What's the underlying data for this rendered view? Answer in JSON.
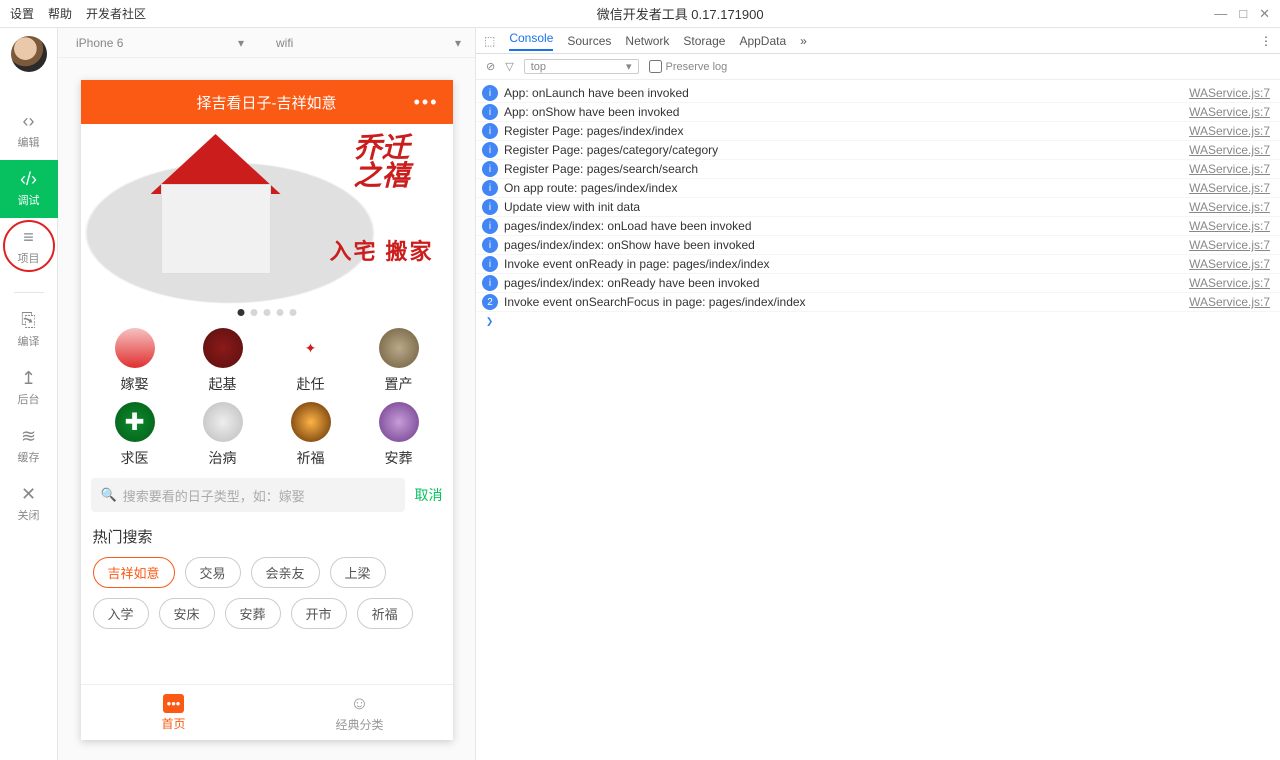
{
  "titlebar": {
    "menus": [
      "设置",
      "帮助",
      "开发者社区"
    ],
    "title": "微信开发者工具 0.17.171900"
  },
  "sidebar": {
    "items": [
      {
        "icon": "‹›",
        "label": "编辑"
      },
      {
        "icon": "‹/›",
        "label": "调试"
      },
      {
        "icon": "≡",
        "label": "项目"
      },
      {
        "icon": "⎘",
        "label": "编译"
      },
      {
        "icon": "↥",
        "label": "后台"
      },
      {
        "icon": "≋",
        "label": "缓存"
      },
      {
        "icon": "✕",
        "label": "关闭"
      }
    ]
  },
  "simtop": {
    "device": "iPhone 6",
    "network": "wifi"
  },
  "phone": {
    "title": "择吉看日子-吉祥如意",
    "banner": {
      "seal": "乔迁\n之禧",
      "moving": "入宅 搬家"
    },
    "grid": [
      {
        "label": "嫁娶",
        "bg": "linear-gradient(#f7c1c1,#e03030)"
      },
      {
        "label": "起基",
        "bg": "radial-gradient(#8b1a1a,#5a0f0f)"
      },
      {
        "label": "赴任",
        "bg": "radial-gradient(#fff,#fff)",
        "fg": "#cc1d1d"
      },
      {
        "label": "置产",
        "bg": "radial-gradient(#b9a88a,#6d5c3a)"
      },
      {
        "label": "求医",
        "bg": "radial-gradient(#0a8a2a,#065c1b)",
        "plus": true
      },
      {
        "label": "治病",
        "bg": "radial-gradient(#eee,#bbb)"
      },
      {
        "label": "祈福",
        "bg": "radial-gradient(#ffb347,#5a2a00)"
      },
      {
        "label": "安葬",
        "bg": "radial-gradient(#c89bd8,#6a3a8a)"
      }
    ],
    "search": {
      "placeholder": "搜索要看的日子类型，如：嫁娶",
      "cancel": "取消"
    },
    "hot": {
      "title": "热门搜索",
      "tags": [
        "吉祥如意",
        "交易",
        "会亲友",
        "上梁",
        "入学",
        "安床",
        "安葬",
        "开市",
        "祈福"
      ]
    },
    "tabs": [
      {
        "icon": "▮",
        "label": "首页"
      },
      {
        "icon": "☺",
        "label": "经典分类"
      }
    ]
  },
  "devtools": {
    "tabs": [
      "Console",
      "Sources",
      "Network",
      "Storage",
      "AppData"
    ],
    "filter": {
      "context": "top",
      "preserve": "Preserve log"
    },
    "logs": [
      {
        "badge": "i",
        "msg": "App: onLaunch have been invoked",
        "src": "WAService.js:7"
      },
      {
        "badge": "i",
        "msg": "App: onShow have been invoked",
        "src": "WAService.js:7"
      },
      {
        "badge": "i",
        "msg": "Register Page: pages/index/index",
        "src": "WAService.js:7"
      },
      {
        "badge": "i",
        "msg": "Register Page: pages/category/category",
        "src": "WAService.js:7"
      },
      {
        "badge": "i",
        "msg": "Register Page: pages/search/search",
        "src": "WAService.js:7"
      },
      {
        "badge": "i",
        "msg": "On app route: pages/index/index",
        "src": "WAService.js:7"
      },
      {
        "badge": "i",
        "msg": "Update view with init data",
        "src": "WAService.js:7"
      },
      {
        "badge": "i",
        "msg": "pages/index/index: onLoad have been invoked",
        "src": "WAService.js:7"
      },
      {
        "badge": "i",
        "msg": "pages/index/index: onShow have been invoked",
        "src": "WAService.js:7"
      },
      {
        "badge": "i",
        "msg": "Invoke event onReady in page: pages/index/index",
        "src": "WAService.js:7"
      },
      {
        "badge": "i",
        "msg": "pages/index/index: onReady have been invoked",
        "src": "WAService.js:7"
      },
      {
        "badge": "2",
        "msg": "Invoke event onSearchFocus in page: pages/index/index",
        "src": "WAService.js:7"
      }
    ]
  }
}
